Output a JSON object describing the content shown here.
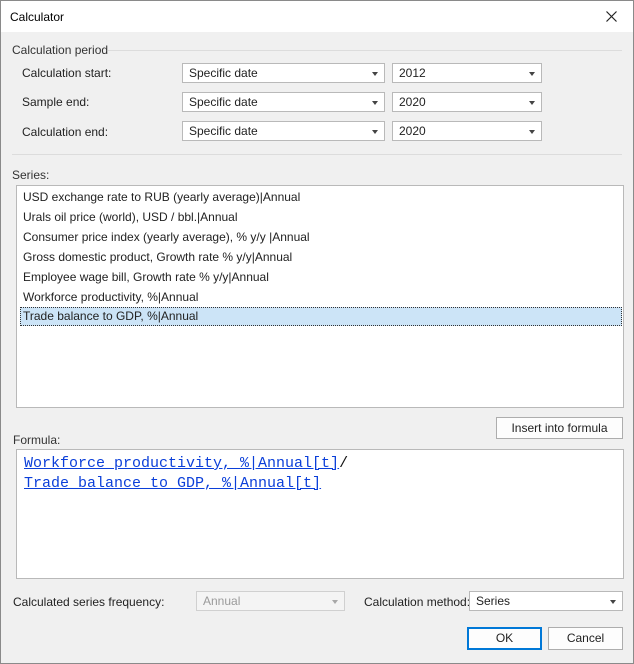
{
  "window": {
    "title": "Calculator"
  },
  "period": {
    "label": "Calculation period",
    "rows": [
      {
        "label": "Calculation start:",
        "mode": "Specific date",
        "value": "2012"
      },
      {
        "label": "Sample end:",
        "mode": "Specific date",
        "value": "2020"
      },
      {
        "label": "Calculation end:",
        "mode": "Specific date",
        "value": "2020"
      }
    ]
  },
  "series": {
    "label": "Series:",
    "items": [
      "USD exchange rate to RUB (yearly average)|Annual",
      "Urals oil price (world), USD / bbl.|Annual",
      "Consumer price index (yearly average), % y/y |Annual",
      "Gross domestic product, Growth rate % y/y|Annual",
      "Employee wage bill, Growth rate % y/y|Annual",
      "Workforce productivity, %|Annual",
      "Trade balance to GDP, %|Annual"
    ],
    "selected_index": 6
  },
  "insert_button": "Insert into formula",
  "formula": {
    "label": "Formula:",
    "line1_link": "Workforce productivity, %|Annual[t]",
    "line1_op": "/",
    "line2_link": "Trade balance to GDP, %|Annual[t]"
  },
  "frequency": {
    "label": "Calculated series frequency:",
    "value": "Annual"
  },
  "method": {
    "label": "Calculation method:",
    "value": "Series"
  },
  "buttons": {
    "ok": "OK",
    "cancel": "Cancel"
  },
  "icons": {
    "close": "close-icon",
    "dropdown": "chevron-down-icon"
  }
}
